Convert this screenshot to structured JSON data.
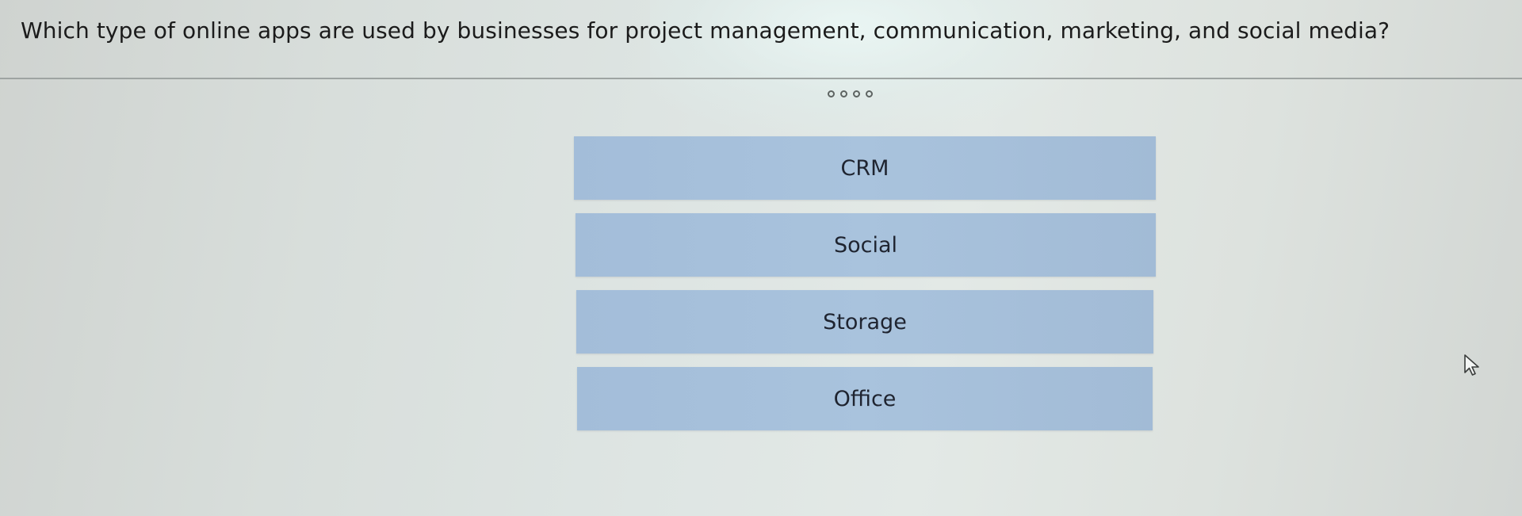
{
  "question": {
    "text": "Which type of online apps are used by businesses for project management, communication, marketing, and social media?"
  },
  "progress": {
    "dot_count": 4
  },
  "answers": [
    {
      "label": "CRM"
    },
    {
      "label": "Social"
    },
    {
      "label": "Storage"
    },
    {
      "label": "Office"
    }
  ],
  "colors": {
    "answer_fill": "#a7c0db",
    "question_divider": "#9ea4a2"
  }
}
